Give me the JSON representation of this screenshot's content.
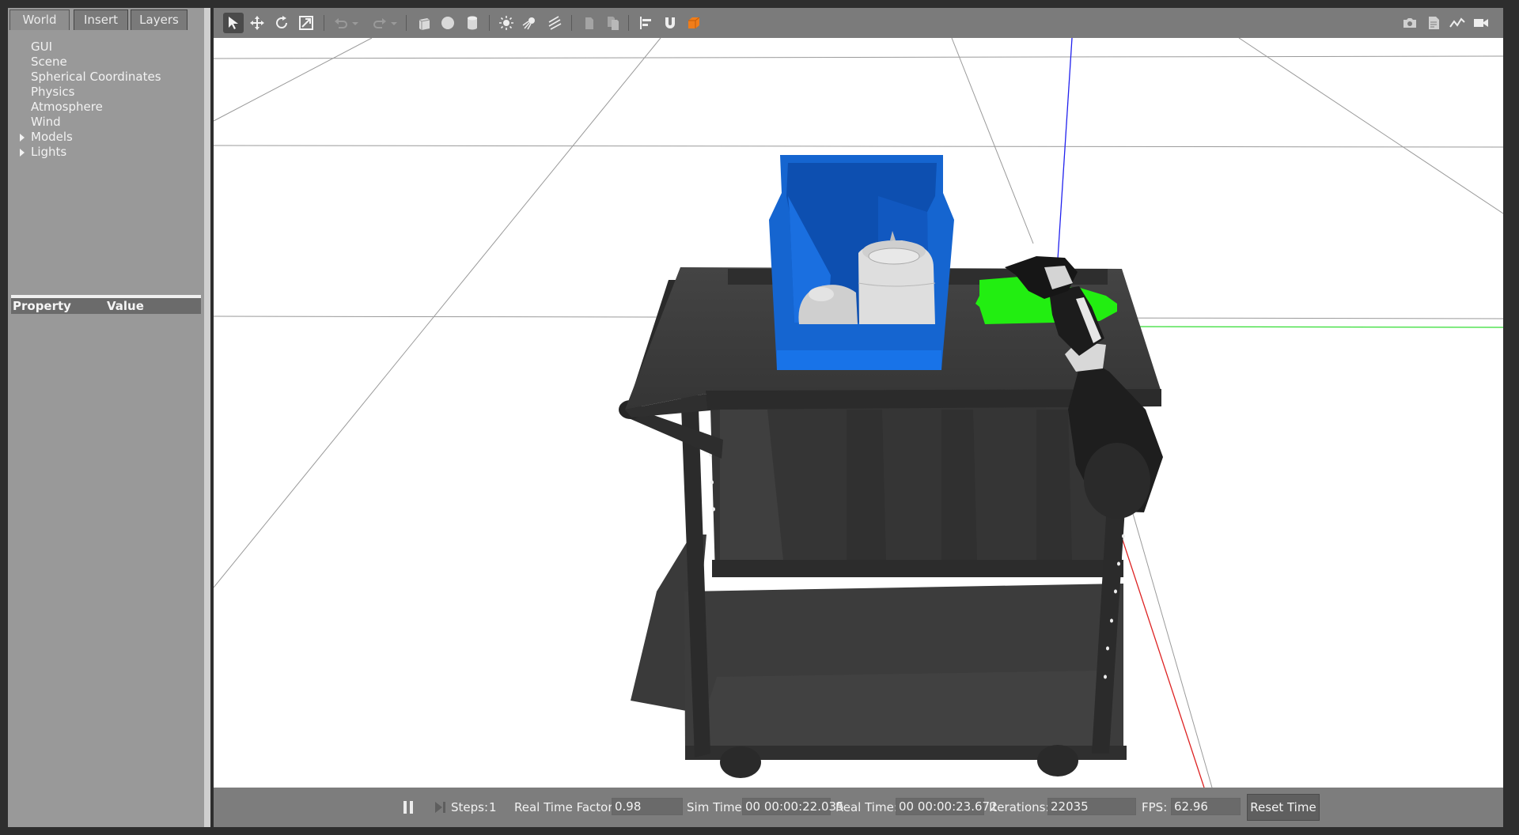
{
  "tabs": [
    {
      "label": "World"
    },
    {
      "label": "Insert"
    },
    {
      "label": "Layers"
    }
  ],
  "world_tree": [
    {
      "label": "GUI"
    },
    {
      "label": "Scene"
    },
    {
      "label": "Spherical Coordinates"
    },
    {
      "label": "Physics"
    },
    {
      "label": "Atmosphere"
    },
    {
      "label": "Wind"
    },
    {
      "label": "Models"
    },
    {
      "label": "Lights"
    }
  ],
  "property_table": {
    "col_property": "Property",
    "col_value": "Value"
  },
  "toolbar": {
    "tools": [
      "select-mode-icon",
      "translate-mode-icon",
      "rotate-mode-icon",
      "scale-mode-icon",
      "undo-icon",
      "redo-icon",
      "box-shape-icon",
      "sphere-shape-icon",
      "cylinder-shape-icon",
      "point-light-icon",
      "spot-light-icon",
      "directional-light-icon",
      "copy-icon",
      "paste-icon",
      "align-icon",
      "snap-icon",
      "change-view-icon",
      "screenshot-icon",
      "log-icon",
      "plot-icon",
      "record-video-icon"
    ],
    "accent": "#f07d1a"
  },
  "bottom_bar": {
    "steps_label": "Steps:",
    "steps_value": "1",
    "rtf_label": "Real Time Factor:",
    "rtf_value": "0.98",
    "sim_time_label": "Sim Time:",
    "sim_time_value": "00 00:00:22.035",
    "real_time_label": "Real Time:",
    "real_time_value": "00 00:00:23.672",
    "iterations_label": "Iterations:",
    "iterations_value": "22035",
    "fps_label": "FPS:",
    "fps_value": "62.96",
    "reset_label": "Reset Time"
  },
  "colors": {
    "bin": "#1565d0",
    "selection": "#22ee11",
    "cart": "#3a3a3a",
    "arm": "#1e1e1e"
  }
}
